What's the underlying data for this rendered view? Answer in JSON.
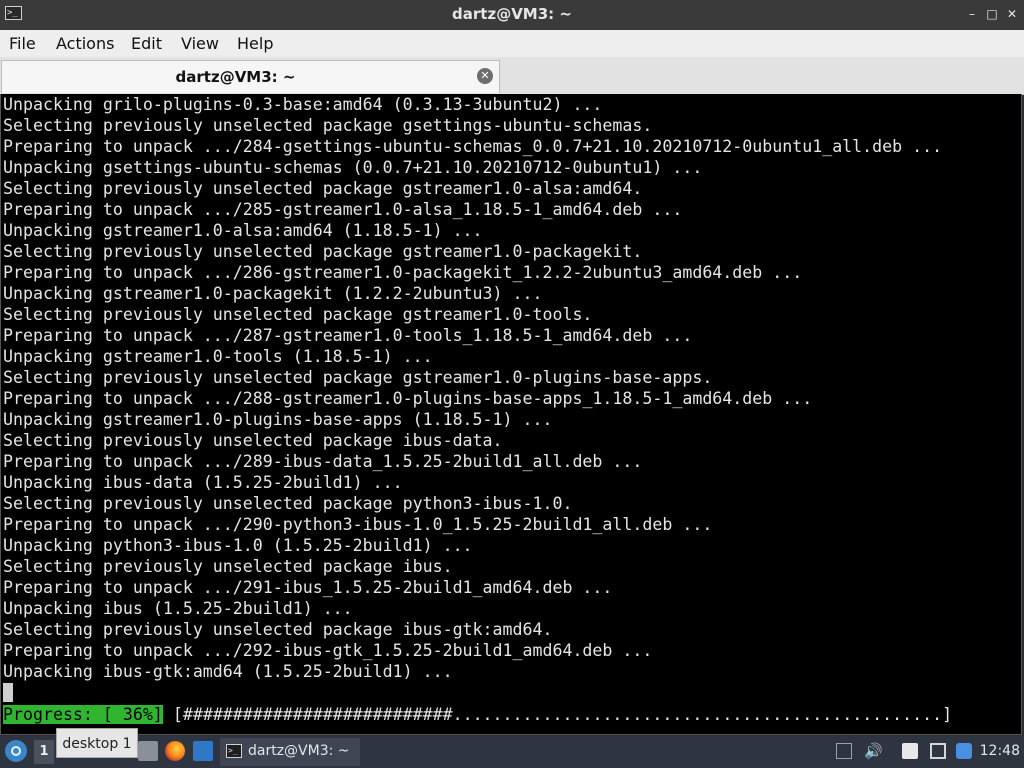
{
  "window": {
    "title": "dartz@VM3: ~",
    "app_icon_glyph": ">_",
    "controls": {
      "minimize": "–",
      "maximize": "□",
      "close": "✕"
    }
  },
  "menu": [
    "File",
    "Actions",
    "Edit",
    "View",
    "Help"
  ],
  "tab": {
    "title": "dartz@VM3: ~",
    "close_glyph": "✕"
  },
  "terminal": {
    "lines": [
      "Unpacking grilo-plugins-0.3-base:amd64 (0.3.13-3ubuntu2) ...",
      "Selecting previously unselected package gsettings-ubuntu-schemas.",
      "Preparing to unpack .../284-gsettings-ubuntu-schemas_0.0.7+21.10.20210712-0ubuntu1_all.deb ...",
      "Unpacking gsettings-ubuntu-schemas (0.0.7+21.10.20210712-0ubuntu1) ...",
      "Selecting previously unselected package gstreamer1.0-alsa:amd64.",
      "Preparing to unpack .../285-gstreamer1.0-alsa_1.18.5-1_amd64.deb ...",
      "Unpacking gstreamer1.0-alsa:amd64 (1.18.5-1) ...",
      "Selecting previously unselected package gstreamer1.0-packagekit.",
      "Preparing to unpack .../286-gstreamer1.0-packagekit_1.2.2-2ubuntu3_amd64.deb ...",
      "Unpacking gstreamer1.0-packagekit (1.2.2-2ubuntu3) ...",
      "Selecting previously unselected package gstreamer1.0-tools.",
      "Preparing to unpack .../287-gstreamer1.0-tools_1.18.5-1_amd64.deb ...",
      "Unpacking gstreamer1.0-tools (1.18.5-1) ...",
      "Selecting previously unselected package gstreamer1.0-plugins-base-apps.",
      "Preparing to unpack .../288-gstreamer1.0-plugins-base-apps_1.18.5-1_amd64.deb ...",
      "Unpacking gstreamer1.0-plugins-base-apps (1.18.5-1) ...",
      "Selecting previously unselected package ibus-data.",
      "Preparing to unpack .../289-ibus-data_1.5.25-2build1_all.deb ...",
      "Unpacking ibus-data (1.5.25-2build1) ...",
      "Selecting previously unselected package python3-ibus-1.0.",
      "Preparing to unpack .../290-python3-ibus-1.0_1.5.25-2build1_all.deb ...",
      "Unpacking python3-ibus-1.0 (1.5.25-2build1) ...",
      "Selecting previously unselected package ibus.",
      "Preparing to unpack .../291-ibus_1.5.25-2build1_amd64.deb ...",
      "Unpacking ibus (1.5.25-2build1) ...",
      "Selecting previously unselected package ibus-gtk:amd64.",
      "Preparing to unpack .../292-ibus-gtk_1.5.25-2build1_amd64.deb ...",
      "Unpacking ibus-gtk:amd64 (1.5.25-2build1) ..."
    ],
    "progress": {
      "label": "Progress: [ 36%]",
      "bar": "[###########################.................................................]",
      "percent": 36
    },
    "colors": {
      "background": "#000000",
      "text": "#e5e5e5",
      "progress_label_bg": "#2fb52f"
    }
  },
  "taskbar": {
    "desktop_number": "1",
    "tooltip": "desktop 1",
    "task_label": "dartz@VM3: ~",
    "clock": "12:48",
    "volume_glyph": "🔊"
  }
}
